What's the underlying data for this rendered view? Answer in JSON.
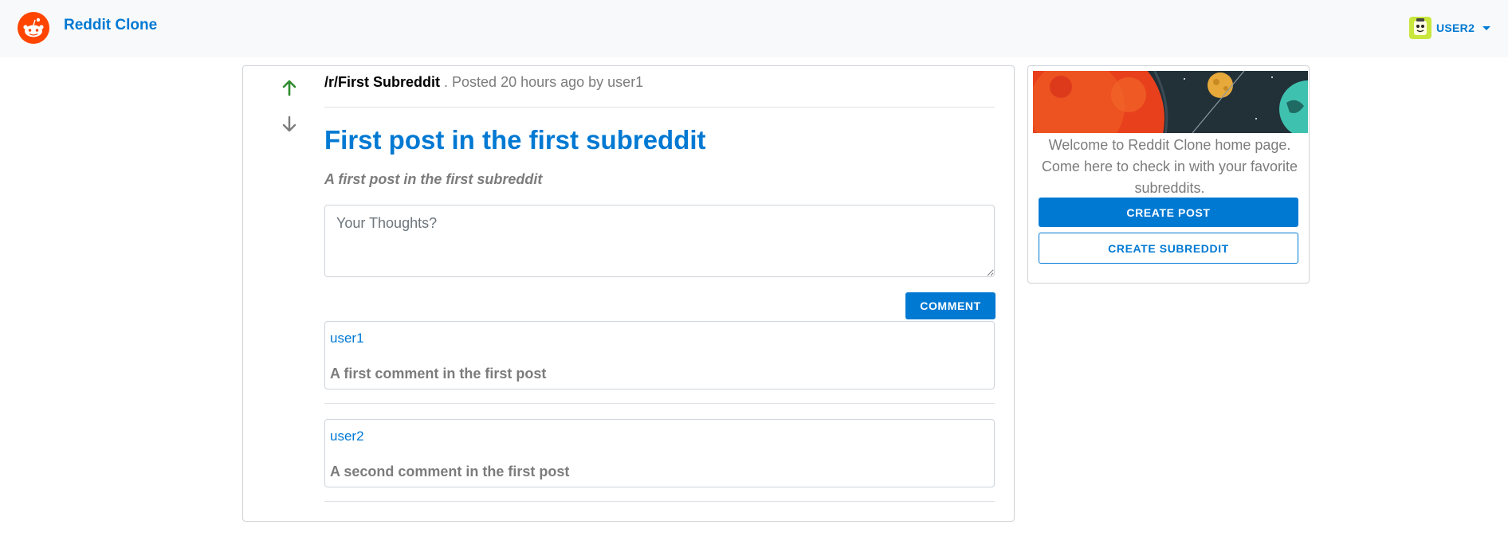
{
  "navbar": {
    "brand": "Reddit Clone",
    "user": {
      "name": "USER2"
    }
  },
  "post": {
    "subreddit": "/r/First Subreddit",
    "meta": ". Posted 20 hours ago by user1",
    "title": "First post in the first subreddit",
    "body": "A first post in the first subreddit",
    "comment_placeholder": "Your Thoughts?",
    "comment_button": "COMMENT",
    "comments": [
      {
        "author": "user1",
        "text": "A first comment in the first post"
      },
      {
        "author": "user2",
        "text": "A second comment in the first post"
      }
    ]
  },
  "sidebar": {
    "welcome_text": "Welcome to Reddit Clone home page. Come here to check in with your favorite subreddits.",
    "create_post": "CREATE POST",
    "create_subreddit": "CREATE SUBREDDIT"
  },
  "colors": {
    "accent": "#0079d3",
    "upvote": "#2e8b2e",
    "logo": "#ff4500",
    "muted": "#7c7c7c"
  }
}
